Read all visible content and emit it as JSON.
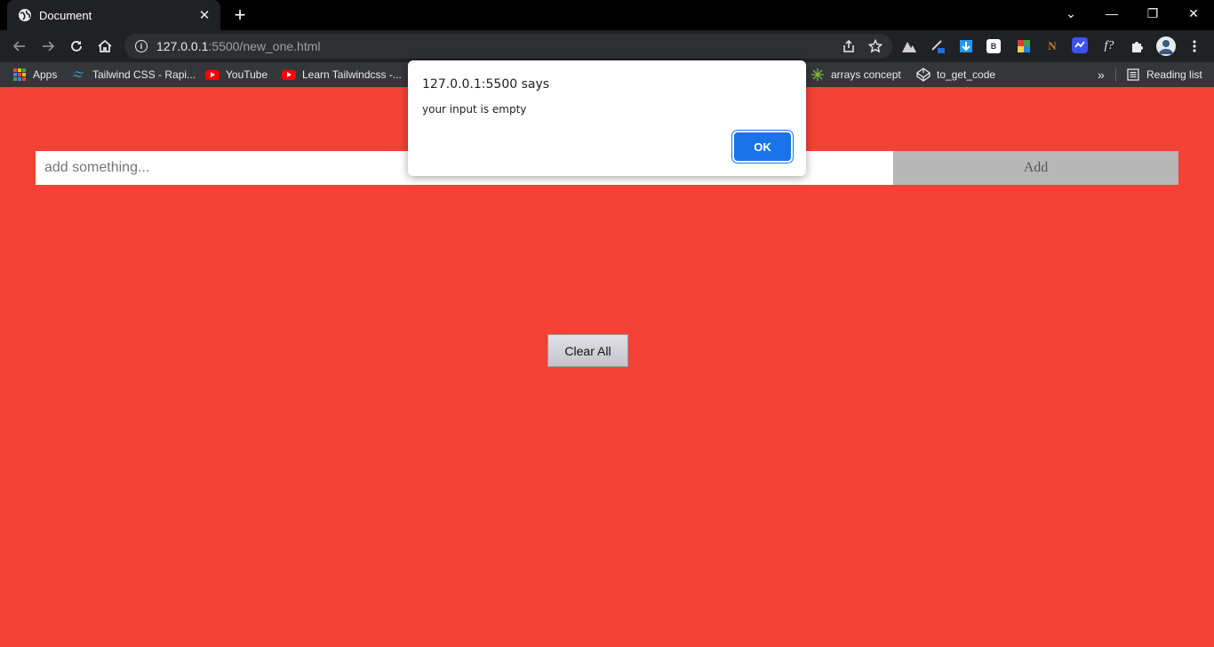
{
  "browser": {
    "tab": {
      "title": "Document",
      "close_glyph": "✕"
    },
    "new_tab_glyph": "+",
    "window_controls": {
      "tab_search": "⌄",
      "minimize": "—",
      "restore": "❐",
      "close": "✕"
    },
    "address": {
      "host": "127.0.0.1",
      "rest": ":5500/new_one.html"
    },
    "extension_labels": {
      "b": "B",
      "n": "N",
      "f": "f?"
    }
  },
  "bookmarks": {
    "apps": "Apps",
    "items": [
      "Tailwind CSS - Rapi...",
      "YouTube",
      "Learn Tailwindcss -...",
      "arrays concept",
      "to_get_code"
    ],
    "overflow": "»",
    "reading_list": "Reading list"
  },
  "page": {
    "input_placeholder": "add something...",
    "add_label": "Add",
    "clear_label": "Clear All",
    "background": "#f44336"
  },
  "dialog": {
    "title": "127.0.0.1:5500 says",
    "message": "your input is empty",
    "ok_label": "OK"
  },
  "colors": {
    "accent": "#1a73e8",
    "page_bg": "#f44336"
  }
}
